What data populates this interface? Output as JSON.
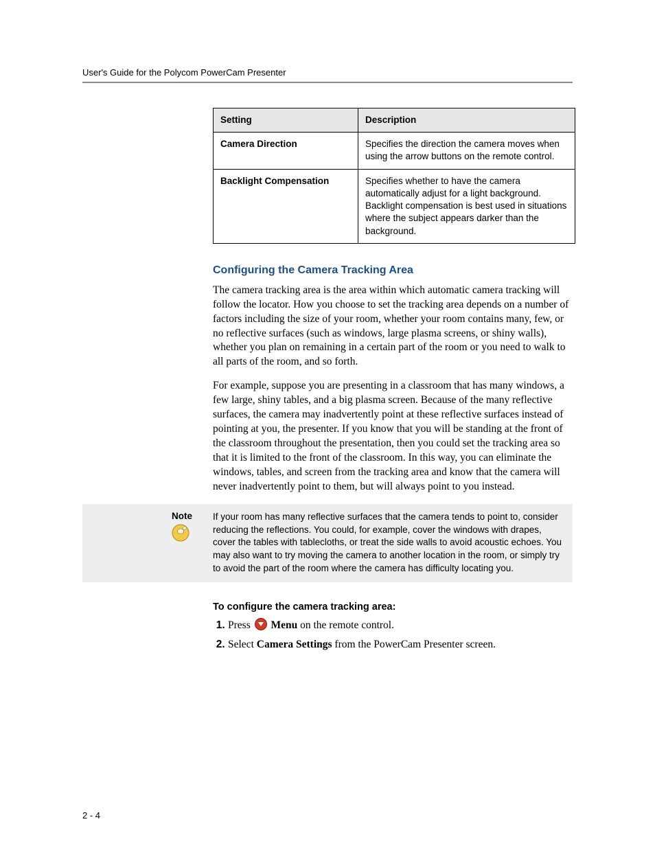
{
  "header": {
    "running_head": "User's Guide for the Polycom PowerCam Presenter"
  },
  "table": {
    "col1": "Setting",
    "col2": "Description",
    "rows": [
      {
        "setting": "Camera Direction",
        "desc": "Specifies the direction the camera moves when using the arrow buttons on the remote control."
      },
      {
        "setting": "Backlight Compensation",
        "desc": "Specifies whether to have the camera automatically adjust for a light background. Backlight compensation is best used in situations where the subject appears darker than the background."
      }
    ]
  },
  "section": {
    "title": "Configuring the Camera Tracking Area",
    "p1": "The camera tracking area is the area within which automatic camera tracking will follow the locator. How you choose to set the tracking area depends on a number of factors including the size of your room, whether your room contains many, few, or no reflective surfaces (such as windows, large plasma screens, or shiny walls), whether you plan on remaining in a certain part of the room or you need to walk to all parts of the room, and so forth.",
    "p2": "For example, suppose you are presenting in a classroom that has many windows, a few large, shiny tables, and a big plasma screen. Because of the many reflective surfaces, the camera may inadvertently point at these reflective surfaces instead of pointing at you, the presenter. If you know that you will be standing at the front of the classroom throughout the presentation, then you could set the tracking area so that it is limited to the front of the classroom. In this way, you can eliminate the windows, tables, and screen from the tracking area and know that the camera will never inadvertently point to them, but will always point to you instead."
  },
  "note": {
    "label": "Note",
    "text": "If your room has many reflective surfaces that the camera tends to point to, consider reducing the reflections. You could, for example, cover the windows with drapes, cover the tables with tablecloths, or treat the side walls to avoid acoustic echoes. You may also want to try moving the camera to another location in the room, or simply try to avoid the part of the room where the camera has difficulty locating you."
  },
  "procedure": {
    "title": "To configure the camera tracking area:",
    "steps": {
      "s1_pre": "Press ",
      "s1_bold": "Menu",
      "s1_post": " on the remote control.",
      "s2_pre": "Select ",
      "s2_bold": "Camera Settings",
      "s2_post": " from the PowerCam Presenter screen."
    }
  },
  "page_number": "2 - 4"
}
